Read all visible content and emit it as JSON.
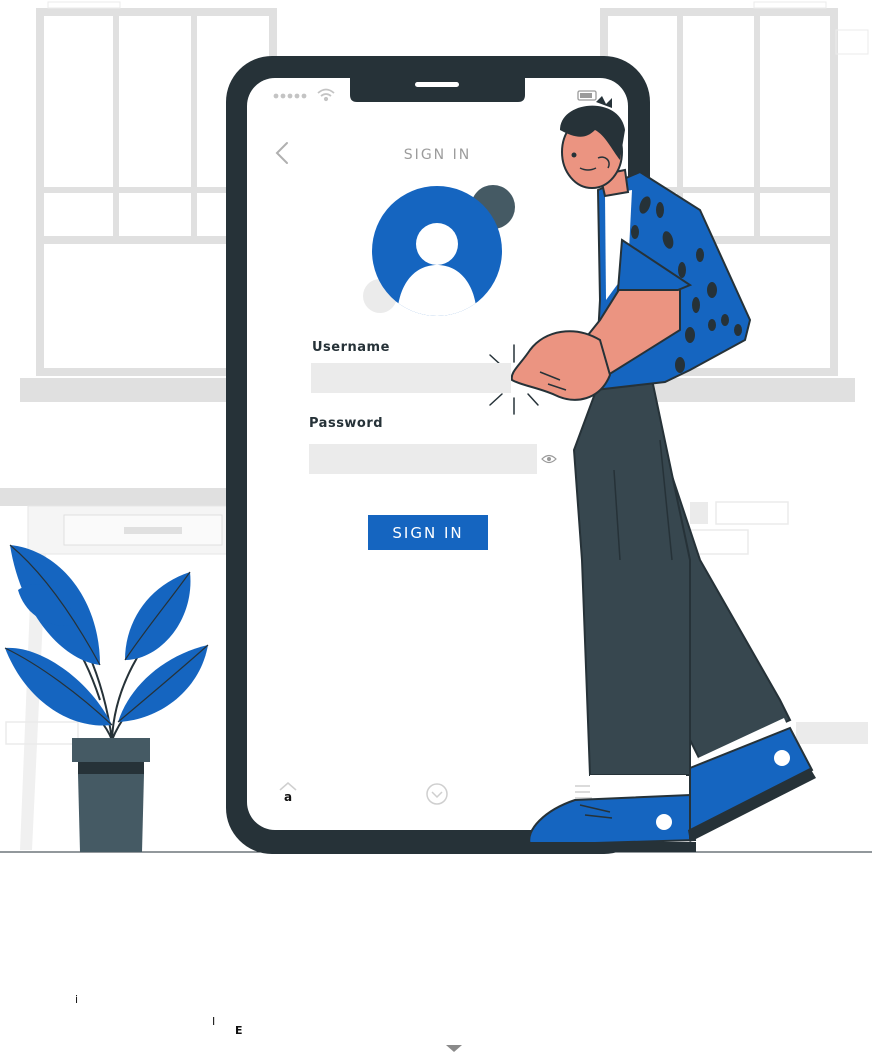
{
  "screen": {
    "title": "SIGN IN",
    "username_label": "Username",
    "username_value": "",
    "password_label": "Password",
    "password_value": "",
    "signin_label": "SIGN IN",
    "home_glyph": "a"
  },
  "stray_glyphs": [
    "i",
    "I",
    "E"
  ],
  "icons": [
    "back-chevron-icon",
    "signal-dots-icon",
    "wifi-icon",
    "battery-icon",
    "avatar-icon",
    "eye-icon",
    "home-icon",
    "chevron-down-circle-icon",
    "menu-lines-icon",
    "caret-down-icon"
  ],
  "colors": {
    "accent_blue": "#1565c0",
    "dark": "#263238",
    "pants": "#37474f",
    "skin": "#eb9481",
    "light_gray": "#ebebeb",
    "window_gray": "#e0e0e0"
  }
}
